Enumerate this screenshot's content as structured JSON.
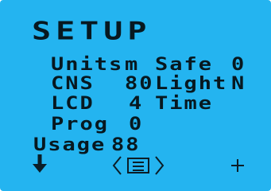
{
  "screen": {
    "title": "SETUP",
    "rows": [
      {
        "label": "Units",
        "value": "m",
        "label2": "Safe",
        "value2": "0"
      },
      {
        "label": "CNS",
        "value": "80",
        "label2": "Light",
        "value2": "N"
      },
      {
        "label": "LCD",
        "value": "4",
        "label2": "Time",
        "value2": ""
      },
      {
        "label": "Prog",
        "value": "0"
      }
    ],
    "usage": {
      "label": "Usage",
      "value": "88"
    }
  },
  "nav": {
    "left_icon": "arrow-down-icon",
    "prev_icon": "chevron-left-icon",
    "center_icon": "menu-icon",
    "next_icon": "chevron-right-icon",
    "right_icon": "plus-icon"
  },
  "colors": {
    "background": "#24b4f0",
    "foreground": "#071820"
  }
}
